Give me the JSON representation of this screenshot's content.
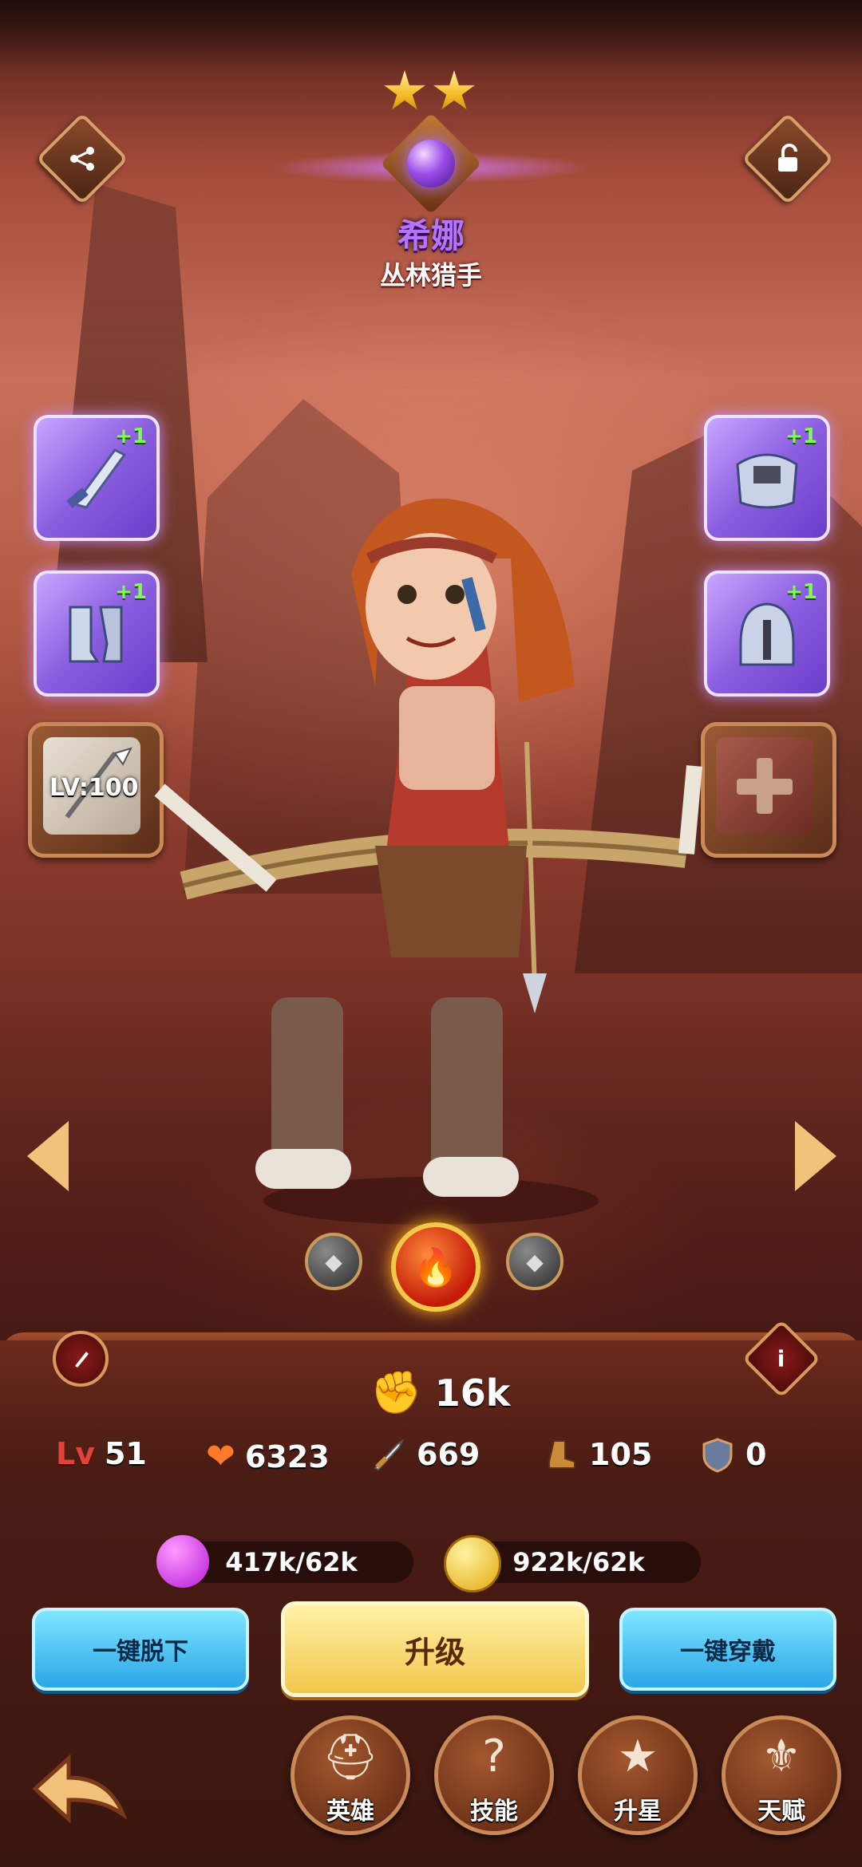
{
  "hero": {
    "name": "希娜",
    "title": "丛林猎手",
    "stars": 2
  },
  "equipment": {
    "weapon_bonus": "+1",
    "boots_bonus": "+1",
    "armor_bonus": "+1",
    "helmet_bonus": "+1",
    "relic_level": "LV:100"
  },
  "stats": {
    "power": "16k",
    "level_label": "Lv",
    "level": "51",
    "health": "6323",
    "attack": "669",
    "speed": "105",
    "defense": "0"
  },
  "resources": {
    "potion": "417k/62k",
    "gold": "922k/62k"
  },
  "actions": {
    "unequip_all": "一键脱下",
    "upgrade": "升级",
    "equip_all": "一键穿戴"
  },
  "nav": {
    "heroes": "英雄",
    "skills": "技能",
    "star_up": "升星",
    "talent": "天赋"
  },
  "icons": {
    "share": "share-icon",
    "lock": "unlock-icon",
    "info": "info-icon"
  },
  "colors": {
    "name_purple": "#b574ff",
    "gold": "#f2c64a",
    "blue_button": "#2aa6e8"
  }
}
